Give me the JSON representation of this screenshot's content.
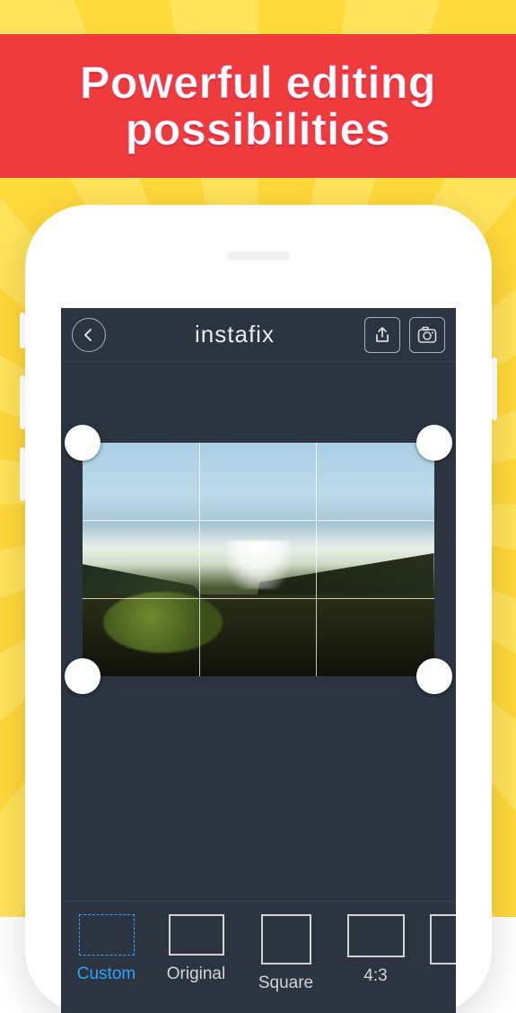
{
  "promo": {
    "headline": "Powerful editing possibilities"
  },
  "app": {
    "title": "instafix"
  },
  "icons": {
    "back": "back-icon",
    "share": "share-icon",
    "camera": "camera-icon"
  },
  "crop_ratios": [
    {
      "id": "custom",
      "label": "Custom",
      "shape": "orig",
      "active": true
    },
    {
      "id": "original",
      "label": "Original",
      "shape": "orig",
      "active": false
    },
    {
      "id": "square",
      "label": "Square",
      "shape": "sq",
      "active": false
    },
    {
      "id": "4_3",
      "label": "4:3",
      "shape": "r43",
      "active": false
    }
  ],
  "colors": {
    "accent": "#2aa4ff",
    "screen_bg": "#2c3440",
    "banner": "#ef3b3b"
  }
}
